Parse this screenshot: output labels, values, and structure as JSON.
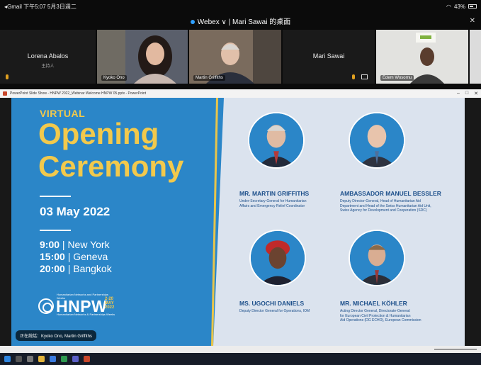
{
  "status_bar": {
    "left": "◂Gmail  下午5:07  5月3日週二",
    "right": "43%"
  },
  "webex": {
    "title": "Webex ∨  |  Mari Sawai 的桌面"
  },
  "participants": [
    {
      "name": "Lorena Abalos",
      "sub": "主持人"
    },
    {
      "name": "Kyoko Ono"
    },
    {
      "name": "Martin Griffiths"
    },
    {
      "name": "Mari Sawai"
    },
    {
      "name": "Edem Wosornu"
    }
  ],
  "app_window": {
    "title": "PowerPoint Slide Show - HNPW 2022_Webinar Welcome HNPW 05.pptx - PowerPoint"
  },
  "slide": {
    "virtual": "VIRTUAL",
    "title_line1": "Opening",
    "title_line2": "Ceremony",
    "date": "03 May 2022",
    "times": [
      {
        "time": "9:00",
        "city": "| New York"
      },
      {
        "time": "15:00",
        "city": "| Geneva"
      },
      {
        "time": "20:00",
        "city": "| Bangkok"
      }
    ],
    "logo": {
      "text": "HNPW",
      "sup": "Humanitarian Networks and Partnerships Weeks",
      "dates": "2-20 MAY 2022",
      "sub": "Humanitarian Networks & Partnerships Weeks"
    },
    "speakers": [
      {
        "name": "MR. MARTIN GRIFFITHS",
        "role": "Under-Secretary-General for Humanitarian\nAffairs and Emergency Relief Coordinator"
      },
      {
        "name": "AMBASSADOR MANUEL BESSLER",
        "role": "Deputy Director-General, Head of Humanitarian Aid\nDepartment and Head of the Swiss Humanitarian Aid Unit,\nSwiss Agency for Development and Cooperation (SDC)"
      },
      {
        "name": "MS. UGOCHI DANIELS",
        "role": "Deputy Director General for Operations, IOM"
      },
      {
        "name": "MR. MICHAEL KÖHLER",
        "role": "Acting Director General, Directorate-General\nfor European Civil Protection & Humanitarian\nAid Operations (DG ECHO), European Commission"
      }
    ]
  },
  "caption": "正在說話：Kyoko Ono, Martin Griffiths",
  "colors": {
    "slide_blue": "#2b86c8",
    "gold": "#f2c94c",
    "navy": "#1c4f8a"
  }
}
